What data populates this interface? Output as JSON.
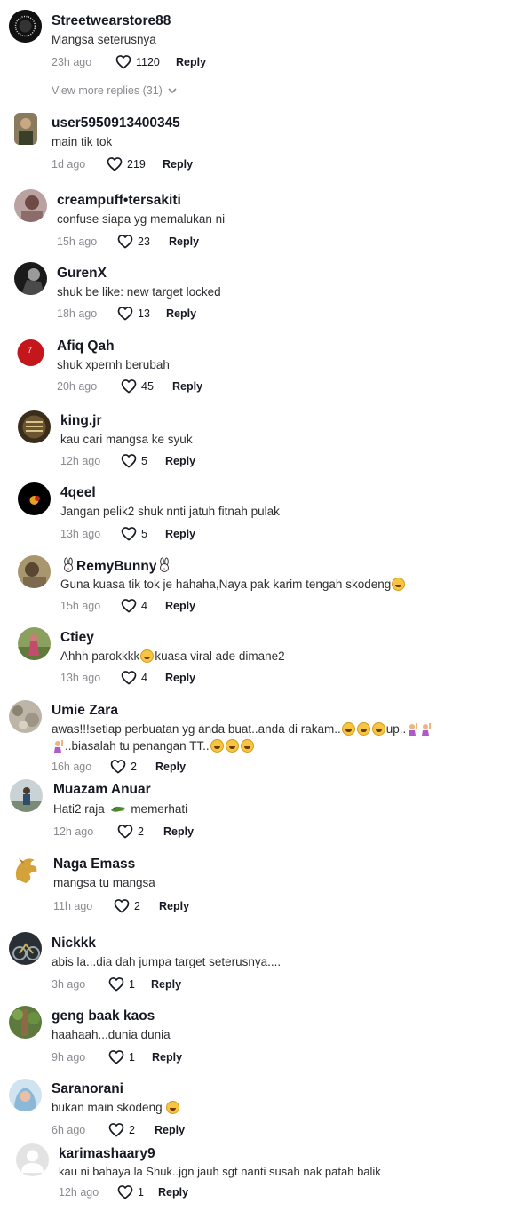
{
  "view_more": "View more replies (31)",
  "comments": [
    {
      "user": "Streetwearstore88",
      "text": "Mangsa seterusnya",
      "time": "23h ago",
      "likes": "1120",
      "reply": "Reply"
    },
    {
      "user": "user5950913400345",
      "text": "main tik tok",
      "time": "1d ago",
      "likes": "219",
      "reply": "Reply"
    },
    {
      "user": "creampuff•tersakiti",
      "text": "confuse siapa yg memalukan ni",
      "time": "15h ago",
      "likes": "23",
      "reply": "Reply"
    },
    {
      "user": "GurenX",
      "text": "shuk be like: new target locked",
      "time": "18h ago",
      "likes": "13",
      "reply": "Reply"
    },
    {
      "user": "Afiq Qah",
      "text": "shuk xpernh berubah",
      "time": "20h ago",
      "likes": "45",
      "reply": "Reply"
    },
    {
      "user": "king.jr",
      "text": "kau cari mangsa ke syuk",
      "time": "12h ago",
      "likes": "5",
      "reply": "Reply"
    },
    {
      "user": "4qeel",
      "text": "Jangan pelik2 shuk nnti jatuh fitnah pulak",
      "time": "13h ago",
      "likes": "5",
      "reply": "Reply"
    },
    {
      "user": "RemyBunny",
      "text": "Guna kuasa tik tok je hahaha,Naya pak karim tengah skodeng",
      "time": "15h ago",
      "likes": "4",
      "reply": "Reply"
    },
    {
      "user": "Ctiey",
      "text_a": "Ahhh parokkkk",
      "text_b": "kuasa viral ade dimane2",
      "time": "13h ago",
      "likes": "4",
      "reply": "Reply"
    },
    {
      "user": "Umie Zara",
      "text_a": "awas!!!setiap perbuatan yg anda buat..anda di rakam..",
      "text_b": "up..",
      "text_c": "..biasalah tu penangan TT..",
      "time": "16h ago",
      "likes": "2",
      "reply": "Reply"
    },
    {
      "user": "Muazam Anuar",
      "text_a": "Hati2 raja",
      "text_b": "memerhati",
      "time": "12h ago",
      "likes": "2",
      "reply": "Reply"
    },
    {
      "user": "Naga Emass",
      "text": "mangsa tu mangsa",
      "time": "11h ago",
      "likes": "2",
      "reply": "Reply"
    },
    {
      "user": "Nickkk",
      "text": "abis la...dia dah jumpa target seterusnya....",
      "time": "3h ago",
      "likes": "1",
      "reply": "Reply"
    },
    {
      "user": "geng baak kaos",
      "text": "haahaah...dunia dunia",
      "time": "9h ago",
      "likes": "1",
      "reply": "Reply"
    },
    {
      "user": "Saranorani",
      "text": "bukan main skodeng",
      "time": "6h ago",
      "likes": "2",
      "reply": "Reply"
    },
    {
      "user": "karimashaary9",
      "text": "kau ni bahaya la Shuk..jgn jauh sgt nanti susah nak patah balik",
      "time": "12h ago",
      "likes": "1",
      "reply": "Reply"
    }
  ]
}
